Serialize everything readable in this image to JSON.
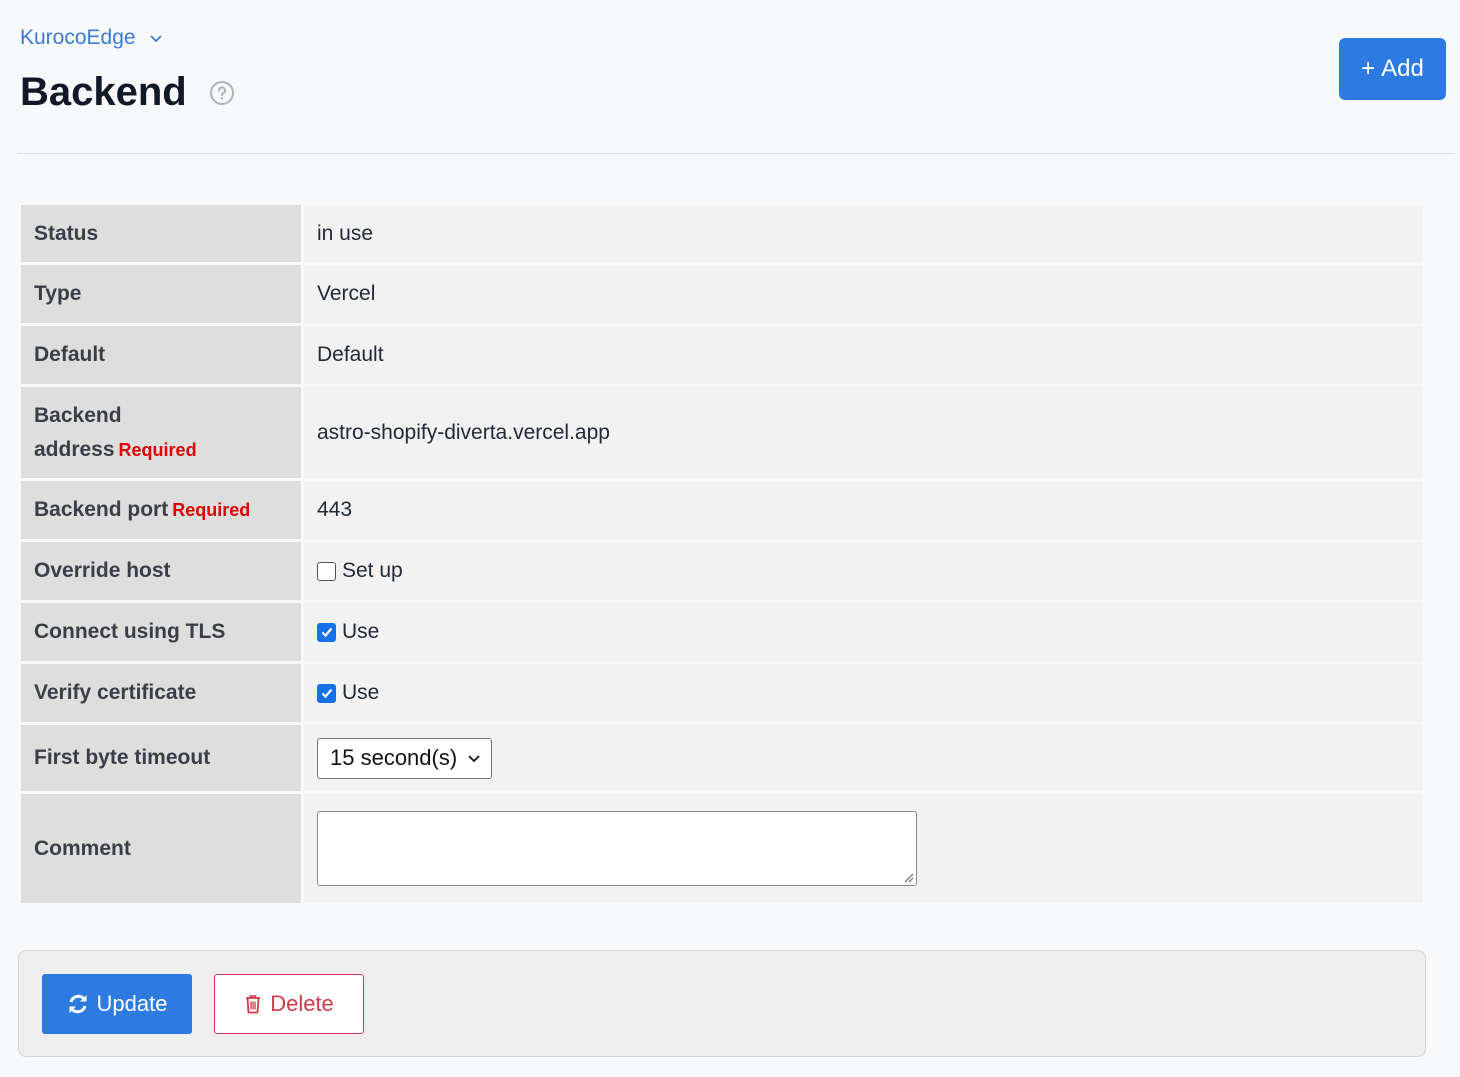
{
  "breadcrumb": {
    "label": "KurocoEdge"
  },
  "page": {
    "title": "Backend"
  },
  "header": {
    "add_label": "Add"
  },
  "form": {
    "required_label": "Required",
    "rows": {
      "status": {
        "label": "Status",
        "value": "in use"
      },
      "type": {
        "label": "Type",
        "value": "Vercel"
      },
      "default": {
        "label": "Default",
        "value": "Default"
      },
      "backend_address": {
        "label_line1": "Backend",
        "label_line2": "address",
        "value": "astro-shopify-diverta.vercel.app"
      },
      "backend_port": {
        "label": "Backend port",
        "value": "443"
      },
      "override_host": {
        "label": "Override host",
        "option": "Set up",
        "checked": false
      },
      "connect_tls": {
        "label": "Connect using TLS",
        "option": "Use",
        "checked": true
      },
      "verify_certificate": {
        "label": "Verify certificate",
        "option": "Use",
        "checked": true
      },
      "first_byte_timeout": {
        "label": "First byte timeout",
        "selected": "15 second(s)"
      },
      "comment": {
        "label": "Comment",
        "value": ""
      }
    }
  },
  "actions": {
    "update_label": "Update",
    "delete_label": "Delete"
  },
  "colors": {
    "primary": "#2d7be0",
    "danger": "#d13a48",
    "required": "#e00000",
    "link": "#3b7bd4"
  }
}
